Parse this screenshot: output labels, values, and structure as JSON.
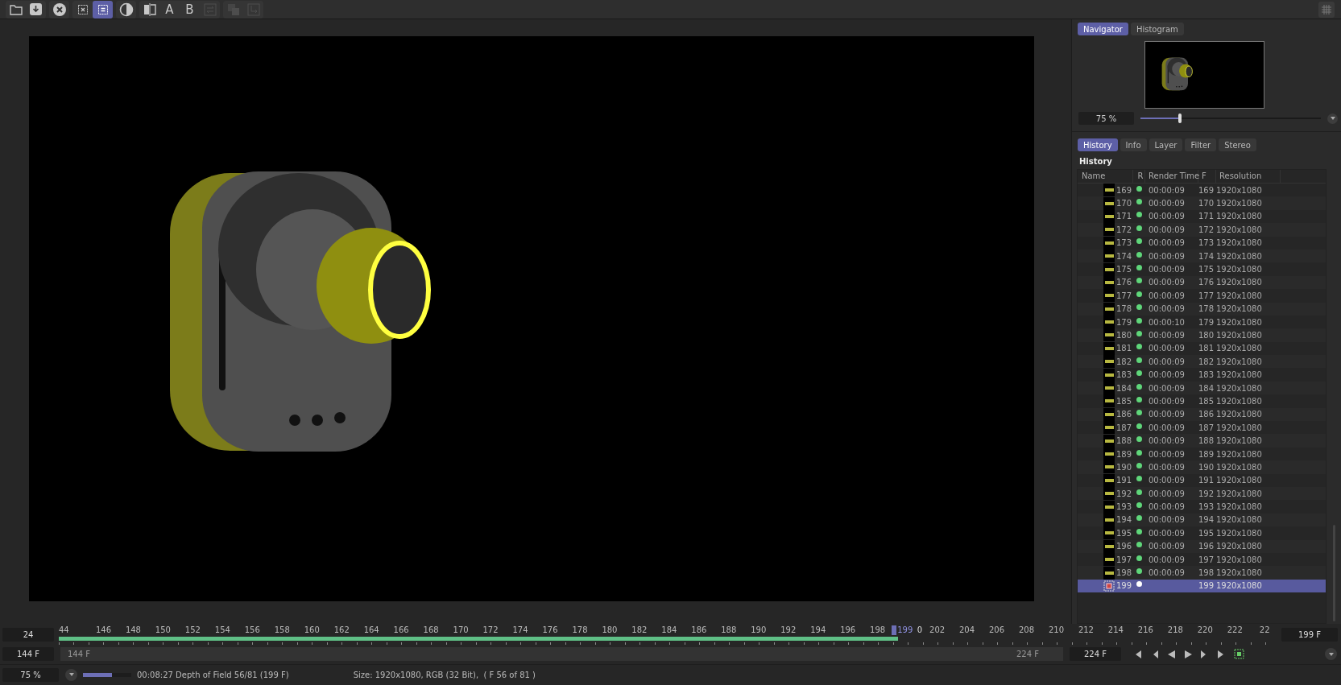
{
  "toolbar": {
    "groups": [
      [
        {
          "kind": "icon",
          "selected": false,
          "disabled": false
        },
        {
          "kind": "icon",
          "selected": false,
          "disabled": false
        }
      ],
      [
        {
          "kind": "icon",
          "selected": false,
          "disabled": false
        }
      ],
      [
        {
          "kind": "icon",
          "selected": false,
          "disabled": false
        },
        {
          "kind": "icon",
          "selected": true,
          "disabled": false
        }
      ],
      [
        {
          "kind": "icon",
          "selected": false,
          "disabled": false
        }
      ],
      [
        {
          "kind": "icon",
          "selected": false,
          "disabled": false
        },
        {
          "kind": "text",
          "label": "A",
          "selected": false,
          "disabled": false
        },
        {
          "kind": "text",
          "label": "B",
          "selected": false,
          "disabled": false
        },
        {
          "kind": "icon",
          "selected": false,
          "disabled": true
        }
      ],
      [
        {
          "kind": "icon",
          "selected": false,
          "disabled": true
        },
        {
          "kind": "icon",
          "selected": false,
          "disabled": true
        }
      ]
    ]
  },
  "navigator": {
    "tabs": [
      {
        "label": "Navigator",
        "selected": true
      },
      {
        "label": "Histogram",
        "selected": false
      }
    ],
    "zoom": {
      "value": "75 %",
      "level": 0.22
    }
  },
  "panel_tabs": [
    {
      "label": "History",
      "selected": true
    },
    {
      "label": "Info",
      "selected": false
    },
    {
      "label": "Layer",
      "selected": false
    },
    {
      "label": "Filter",
      "selected": false
    },
    {
      "label": "Stereo",
      "selected": false
    }
  ],
  "history": {
    "title": "History",
    "columns": [
      "Name",
      "R",
      "Render Time",
      "F",
      "Resolution"
    ],
    "rows": [
      {
        "name": "169",
        "rendered": true,
        "render_time": "00:00:09",
        "frame": "169",
        "resolution": "1920x1080",
        "selected": false
      },
      {
        "name": "170",
        "rendered": true,
        "render_time": "00:00:09",
        "frame": "170",
        "resolution": "1920x1080",
        "selected": false
      },
      {
        "name": "171",
        "rendered": true,
        "render_time": "00:00:09",
        "frame": "171",
        "resolution": "1920x1080",
        "selected": false
      },
      {
        "name": "172",
        "rendered": true,
        "render_time": "00:00:09",
        "frame": "172",
        "resolution": "1920x1080",
        "selected": false
      },
      {
        "name": "173",
        "rendered": true,
        "render_time": "00:00:09",
        "frame": "173",
        "resolution": "1920x1080",
        "selected": false
      },
      {
        "name": "174",
        "rendered": true,
        "render_time": "00:00:09",
        "frame": "174",
        "resolution": "1920x1080",
        "selected": false
      },
      {
        "name": "175",
        "rendered": true,
        "render_time": "00:00:09",
        "frame": "175",
        "resolution": "1920x1080",
        "selected": false
      },
      {
        "name": "176",
        "rendered": true,
        "render_time": "00:00:09",
        "frame": "176",
        "resolution": "1920x1080",
        "selected": false
      },
      {
        "name": "177",
        "rendered": true,
        "render_time": "00:00:09",
        "frame": "177",
        "resolution": "1920x1080",
        "selected": false
      },
      {
        "name": "178",
        "rendered": true,
        "render_time": "00:00:09",
        "frame": "178",
        "resolution": "1920x1080",
        "selected": false
      },
      {
        "name": "179",
        "rendered": true,
        "render_time": "00:00:10",
        "frame": "179",
        "resolution": "1920x1080",
        "selected": false
      },
      {
        "name": "180",
        "rendered": true,
        "render_time": "00:00:09",
        "frame": "180",
        "resolution": "1920x1080",
        "selected": false
      },
      {
        "name": "181",
        "rendered": true,
        "render_time": "00:00:09",
        "frame": "181",
        "resolution": "1920x1080",
        "selected": false
      },
      {
        "name": "182",
        "rendered": true,
        "render_time": "00:00:09",
        "frame": "182",
        "resolution": "1920x1080",
        "selected": false
      },
      {
        "name": "183",
        "rendered": true,
        "render_time": "00:00:09",
        "frame": "183",
        "resolution": "1920x1080",
        "selected": false
      },
      {
        "name": "184",
        "rendered": true,
        "render_time": "00:00:09",
        "frame": "184",
        "resolution": "1920x1080",
        "selected": false
      },
      {
        "name": "185",
        "rendered": true,
        "render_time": "00:00:09",
        "frame": "185",
        "resolution": "1920x1080",
        "selected": false
      },
      {
        "name": "186",
        "rendered": true,
        "render_time": "00:00:09",
        "frame": "186",
        "resolution": "1920x1080",
        "selected": false
      },
      {
        "name": "187",
        "rendered": true,
        "render_time": "00:00:09",
        "frame": "187",
        "resolution": "1920x1080",
        "selected": false
      },
      {
        "name": "188",
        "rendered": true,
        "render_time": "00:00:09",
        "frame": "188",
        "resolution": "1920x1080",
        "selected": false
      },
      {
        "name": "189",
        "rendered": true,
        "render_time": "00:00:09",
        "frame": "189",
        "resolution": "1920x1080",
        "selected": false
      },
      {
        "name": "190",
        "rendered": true,
        "render_time": "00:00:09",
        "frame": "190",
        "resolution": "1920x1080",
        "selected": false
      },
      {
        "name": "191",
        "rendered": true,
        "render_time": "00:00:09",
        "frame": "191",
        "resolution": "1920x1080",
        "selected": false
      },
      {
        "name": "192",
        "rendered": true,
        "render_time": "00:00:09",
        "frame": "192",
        "resolution": "1920x1080",
        "selected": false
      },
      {
        "name": "193",
        "rendered": true,
        "render_time": "00:00:09",
        "frame": "193",
        "resolution": "1920x1080",
        "selected": false
      },
      {
        "name": "194",
        "rendered": true,
        "render_time": "00:00:09",
        "frame": "194",
        "resolution": "1920x1080",
        "selected": false
      },
      {
        "name": "195",
        "rendered": true,
        "render_time": "00:00:09",
        "frame": "195",
        "resolution": "1920x1080",
        "selected": false
      },
      {
        "name": "196",
        "rendered": true,
        "render_time": "00:00:09",
        "frame": "196",
        "resolution": "1920x1080",
        "selected": false
      },
      {
        "name": "197",
        "rendered": true,
        "render_time": "00:00:09",
        "frame": "197",
        "resolution": "1920x1080",
        "selected": false
      },
      {
        "name": "198",
        "rendered": true,
        "render_time": "00:00:09",
        "frame": "198",
        "resolution": "1920x1080",
        "selected": false
      },
      {
        "name": "199",
        "rendered": false,
        "frame": "199",
        "resolution": "1920x1080",
        "selected": true
      }
    ]
  },
  "timeline": {
    "fps": "24",
    "ticks": [
      "44",
      "146",
      "148",
      "150",
      "152",
      "154",
      "156",
      "158",
      "160",
      "162",
      "164",
      "166",
      "168",
      "170",
      "172",
      "174",
      "176",
      "178",
      "180",
      "182",
      "184",
      "186",
      "188",
      "190",
      "192",
      "194",
      "196",
      "198",
      "0",
      "202",
      "204",
      "206",
      "208",
      "210",
      "212",
      "214",
      "216",
      "218",
      "220",
      "222",
      "22"
    ],
    "current": {
      "label": "199",
      "level": 0.6875
    },
    "current_field": "199 F",
    "range": {
      "start_field": "144 F",
      "start_label": "144 F",
      "end_label": "224 F",
      "end_field": "224 F"
    }
  },
  "status_bar": {
    "zoom": "75 %",
    "progress": {
      "level": 0.6
    },
    "render_status": "00:08:27 Depth of Field 56/81 (199 F)",
    "image_info": "Size: 1920x1080, RGB (32 Bit),  ( F 56 of 81 )"
  }
}
